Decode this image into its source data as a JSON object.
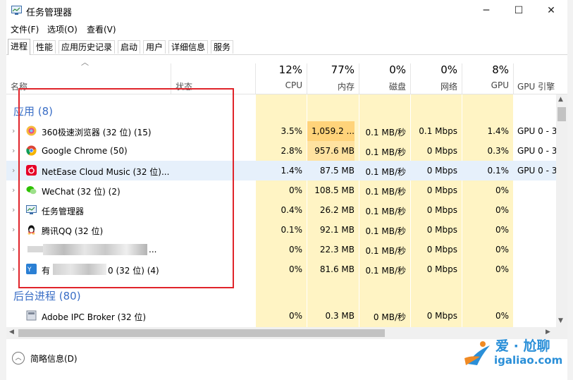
{
  "window": {
    "title": "任务管理器",
    "controls": [
      "─",
      "☐",
      "✕"
    ]
  },
  "menu": [
    "文件(F)",
    "选项(O)",
    "查看(V)"
  ],
  "tabs": [
    "进程",
    "性能",
    "应用历史记录",
    "启动",
    "用户",
    "详细信息",
    "服务"
  ],
  "active_tab": "进程",
  "columns": {
    "name": "名称",
    "status": "状态",
    "cpu": {
      "pct": "12%",
      "label": "CPU"
    },
    "memory": {
      "pct": "77%",
      "label": "内存"
    },
    "disk": {
      "pct": "0%",
      "label": "磁盘"
    },
    "network": {
      "pct": "0%",
      "label": "网络"
    },
    "gpu": {
      "pct": "8%",
      "label": "GPU"
    },
    "gpu_engine": {
      "label": "GPU 引擎"
    }
  },
  "groups": {
    "apps": "应用 (8)",
    "background": "后台进程 (80)"
  },
  "rows": [
    {
      "name": "360极速浏览器 (32 位) (15)",
      "icon": "360-browser-icon",
      "cpu": "3.5%",
      "mem": "1,059.2 ...",
      "disk": "0.1 MB/秒",
      "net": "0.1 Mbps",
      "gpu": "1.4%",
      "engine": "GPU 0 - 3"
    },
    {
      "name": "Google Chrome (50)",
      "icon": "chrome-icon",
      "cpu": "2.8%",
      "mem": "957.6 MB",
      "disk": "0.1 MB/秒",
      "net": "0 Mbps",
      "gpu": "0.3%",
      "engine": "GPU 0 - 3"
    },
    {
      "name": "NetEase Cloud Music (32 位)...",
      "icon": "netease-music-icon",
      "cpu": "1.4%",
      "mem": "87.5 MB",
      "disk": "0.1 MB/秒",
      "net": "0 Mbps",
      "gpu": "0.1%",
      "engine": "GPU 0 - 3"
    },
    {
      "name": "WeChat (32 位) (2)",
      "icon": "wechat-icon",
      "cpu": "0%",
      "mem": "108.5 MB",
      "disk": "0.1 MB/秒",
      "net": "0 Mbps",
      "gpu": "0%",
      "engine": ""
    },
    {
      "name": "任务管理器",
      "icon": "task-manager-icon",
      "cpu": "0.4%",
      "mem": "26.2 MB",
      "disk": "0.1 MB/秒",
      "net": "0 Mbps",
      "gpu": "0%",
      "engine": ""
    },
    {
      "name": "腾讯QQ (32 位)",
      "icon": "qq-icon",
      "cpu": "0.1%",
      "mem": "92.1 MB",
      "disk": "0.1 MB/秒",
      "net": "0 Mbps",
      "gpu": "0%",
      "engine": ""
    },
    {
      "name": "...",
      "icon": "app-icon",
      "cpu": "0%",
      "mem": "22.3 MB",
      "disk": "0.1 MB/秒",
      "net": "0 Mbps",
      "gpu": "0%",
      "engine": ""
    },
    {
      "name_prefix": "有",
      "name_suffix": "0 (32 位) (4)",
      "icon": "app-blue-icon",
      "cpu": "0%",
      "mem": "81.6 MB",
      "disk": "0.1 MB/秒",
      "net": "0 Mbps",
      "gpu": "0%",
      "engine": ""
    },
    {
      "name": "Adobe IPC Broker (32 位)",
      "icon": "adobe-icon",
      "cpu": "0%",
      "mem": "0.3 MB",
      "disk": "0 MB/秒",
      "net": "0 Mbps",
      "gpu": "0%",
      "engine": ""
    }
  ],
  "footer": {
    "fewer_details": "简略信息(D)"
  },
  "watermark": {
    "line1": "爱 · 尬聊",
    "line2": "igaliao.com"
  },
  "colors": {
    "group_blue": "#3a6ec6",
    "highlight_box": "#e0242a",
    "heat_light": "#fff4c4",
    "heat_medium": "#ffe8a3",
    "heat_strong": "#ffd37a"
  }
}
